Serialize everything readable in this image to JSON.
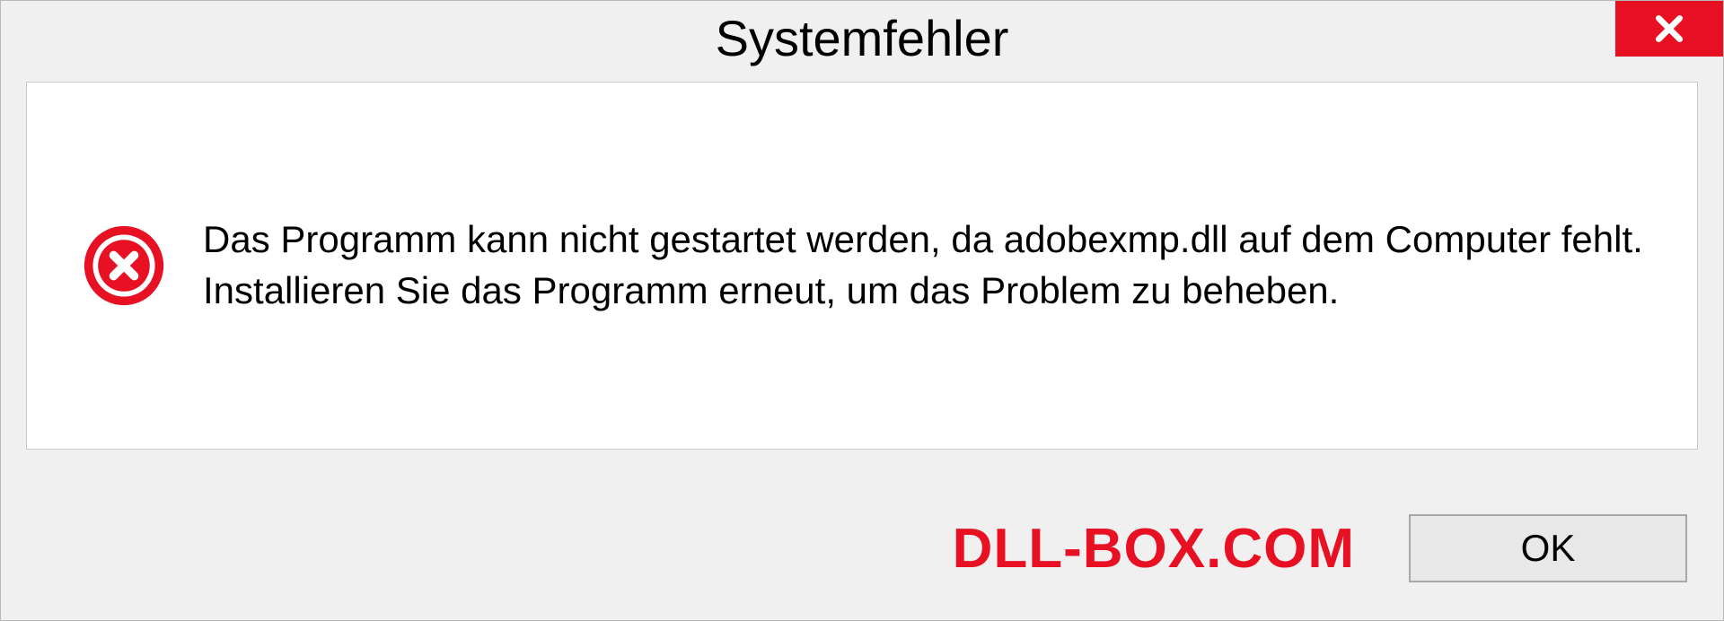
{
  "dialog": {
    "title": "Systemfehler",
    "message": "Das Programm kann nicht gestartet werden, da adobexmp.dll auf dem Computer fehlt. Installieren Sie das Programm erneut, um das Problem zu beheben.",
    "ok_label": "OK",
    "watermark": "DLL-BOX.COM"
  },
  "colors": {
    "close_bg": "#e81123",
    "error_icon": "#e81123",
    "watermark": "#e81123"
  }
}
